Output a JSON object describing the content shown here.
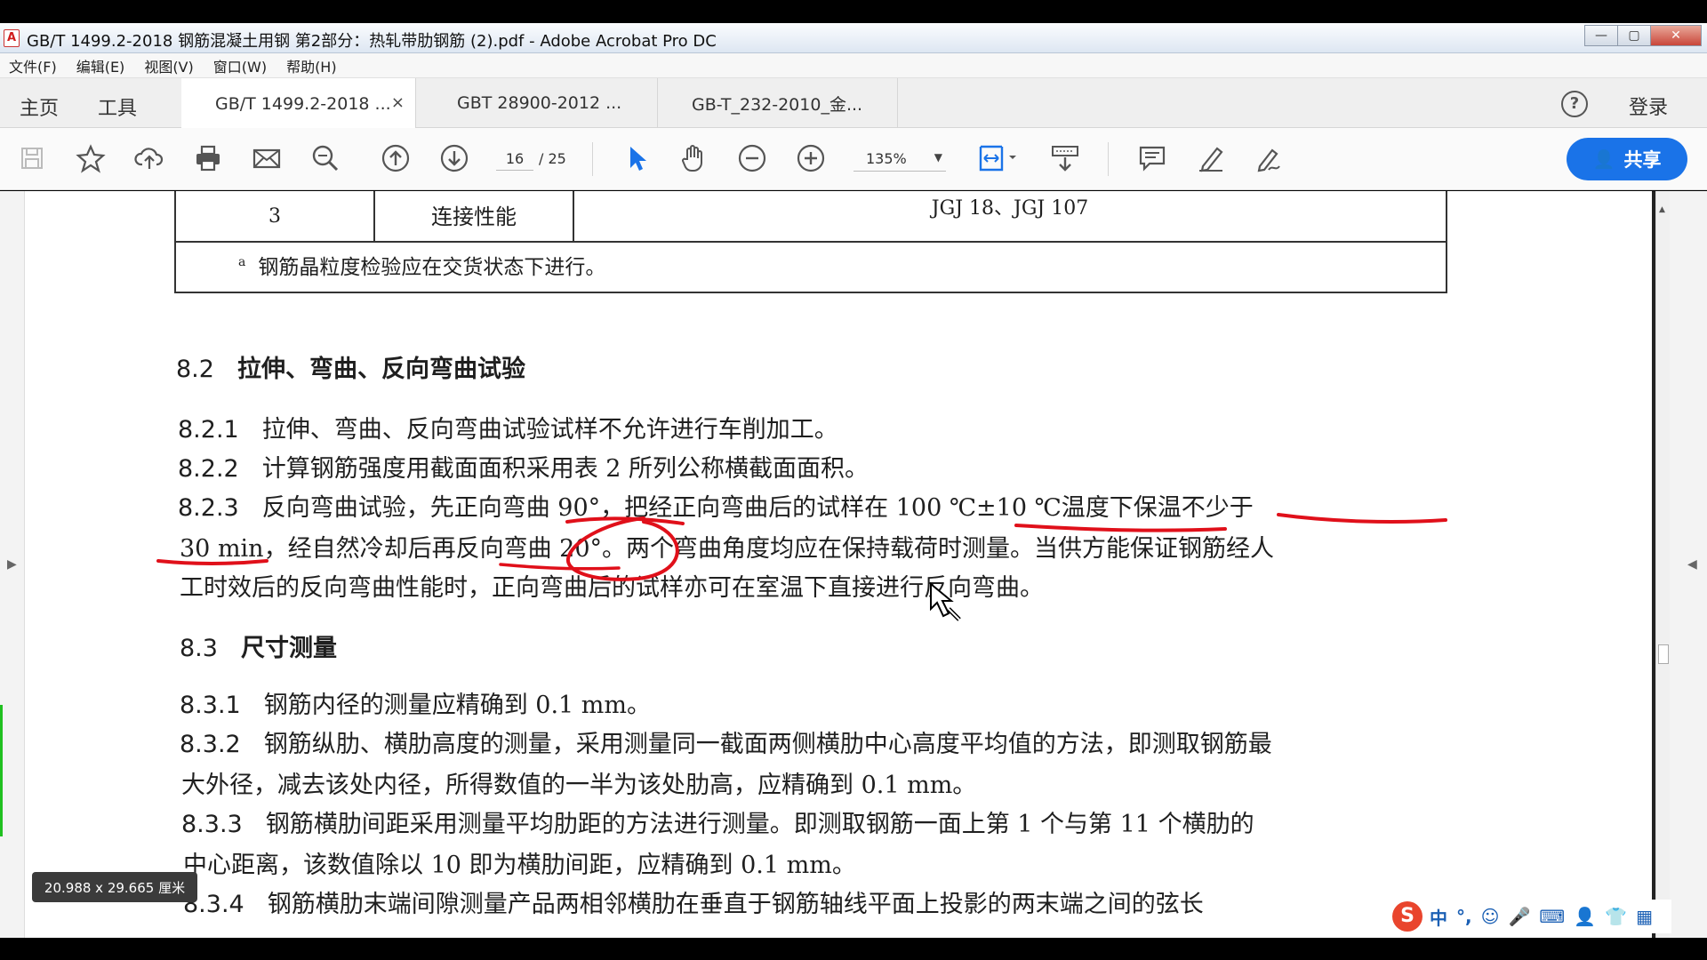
{
  "window": {
    "title": "GB/T 1499.2-2018 钢筋混凝土用钢 第2部分：热轧带肋钢筋 (2).pdf - Adobe Acrobat Pro DC",
    "app_icon": "acrobat-icon",
    "controls": {
      "minimize": "—",
      "maximize": "▢",
      "close": "✕"
    }
  },
  "menubar": [
    "文件(F)",
    "编辑(E)",
    "视图(V)",
    "窗口(W)",
    "帮助(H)"
  ],
  "tabbar": {
    "home": "主页",
    "tools": "工具",
    "docs": [
      {
        "label": "GB/T 1499.2-2018 ...",
        "active": true,
        "close": "×"
      },
      {
        "label": "GBT 28900-2012 ...",
        "active": false
      },
      {
        "label": "GB-T_232-2010_金...",
        "active": false
      }
    ],
    "help": "?",
    "login": "登录"
  },
  "toolbar": {
    "icons": [
      "save-icon",
      "star-icon",
      "upload-icon",
      "print-icon",
      "mail-icon",
      "search-zoom-icon",
      "page-up-icon",
      "page-down-icon",
      "select-icon",
      "hand-icon",
      "zoom-out-icon",
      "zoom-in-icon",
      "fit-page-icon",
      "scroll-mode-icon",
      "comment-icon",
      "highlight-icon",
      "sign-icon"
    ],
    "page_current": "16",
    "page_total": "/ 25",
    "zoom": "135%",
    "zoom_caret": "▼",
    "share": "共享"
  },
  "document": {
    "table": {
      "num": "3",
      "item": "连接性能",
      "standard": "JGJ 18、JGJ 107",
      "note_mark": "a",
      "note": "钢筋晶粒度检验应在交货状态下进行。"
    },
    "s82": {
      "num": "8.2",
      "text": "拉伸、弯曲、反向弯曲试验"
    },
    "s821": {
      "num": "8.2.1",
      "text": "拉伸、弯曲、反向弯曲试验试样不允许进行车削加工。"
    },
    "s822": {
      "num": "8.2.2",
      "text": "计算钢筋强度用截面面积采用表 2 所列公称横截面面积。"
    },
    "s823": {
      "num": "8.2.3",
      "line1": "反向弯曲试验，先正向弯曲 90°，把经正向弯曲后的试样在 100 ℃±10 ℃温度下保温不少于",
      "line2": "30 min，经自然冷却后再反向弯曲 20°。两个弯曲角度均应在保持载荷时测量。当供方能保证钢筋经人",
      "line3": "工时效后的反向弯曲性能时，正向弯曲后的试样亦可在室温下直接进行反向弯曲。"
    },
    "s83": {
      "num": "8.3",
      "text": "尺寸测量"
    },
    "s831": {
      "num": "8.3.1",
      "text": "钢筋内径的测量应精确到 0.1 mm。"
    },
    "s832": {
      "num": "8.3.2",
      "line1": "钢筋纵肋、横肋高度的测量，采用测量同一截面两侧横肋中心高度平均值的方法，即测取钢筋最",
      "line2": "大外径，减去该处内径，所得数值的一半为该处肋高，应精确到 0.1 mm。"
    },
    "s833": {
      "num": "8.3.3",
      "line1": "钢筋横肋间距采用测量平均肋距的方法进行测量。即测取钢筋一面上第 1 个与第 11 个横肋的",
      "line2": "中心距离，该数值除以 10 即为横肋间距，应精确到 0.1 mm。"
    },
    "s834": {
      "num": "8.3.4",
      "text": "钢筋横肋末端间隙测量产品两相邻横肋在垂直于钢筋轴线平面上投影的两末端之间的弦长"
    },
    "annotation_color": "#e0101a"
  },
  "status": {
    "page_size": "20.988 x 29.665 厘米"
  },
  "ime": {
    "logo": "S",
    "items": [
      "中",
      "°,",
      "☺",
      "🎤",
      "⌨",
      "👤",
      "👕",
      "▦"
    ]
  }
}
